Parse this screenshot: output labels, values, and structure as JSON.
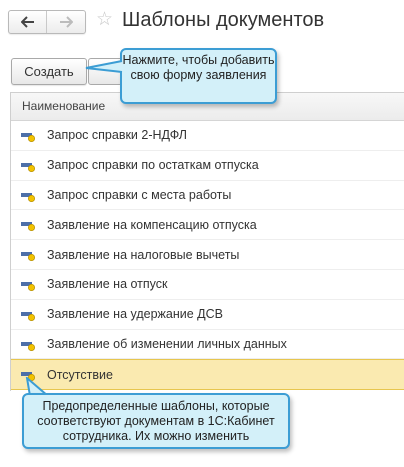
{
  "header": {
    "title": "Шаблоны документов",
    "back_icon": "arrow-left-icon",
    "forward_icon": "arrow-right-icon",
    "favorite_icon": "star-icon"
  },
  "toolbar": {
    "create_label": "Создать"
  },
  "table": {
    "column_header": "Наименование",
    "rows": [
      "Запрос справки 2-НДФЛ",
      "Запрос справки по остаткам отпуска",
      "Запрос справки с места работы",
      "Заявление на компенсацию отпуска",
      "Заявление на налоговые вычеты",
      "Заявление на отпуск",
      "Заявление на удержание ДСВ",
      "Заявление об изменении личных данных",
      "Отсутствие"
    ],
    "selected_index": 8
  },
  "callouts": {
    "top_text": "Нажмите, чтобы добавить свою форму заявления",
    "bottom_text": "Предопределенные шаблоны, которые соответствуют документам в 1С:Кабинет сотрудника. Их можно изменить"
  },
  "colors": {
    "callout_fill": "#d3f0f9",
    "callout_border": "#3c9dd4",
    "selected_row": "#faeab0",
    "icon_yellow": "#f2c200",
    "icon_blue": "#4d6fa8"
  }
}
